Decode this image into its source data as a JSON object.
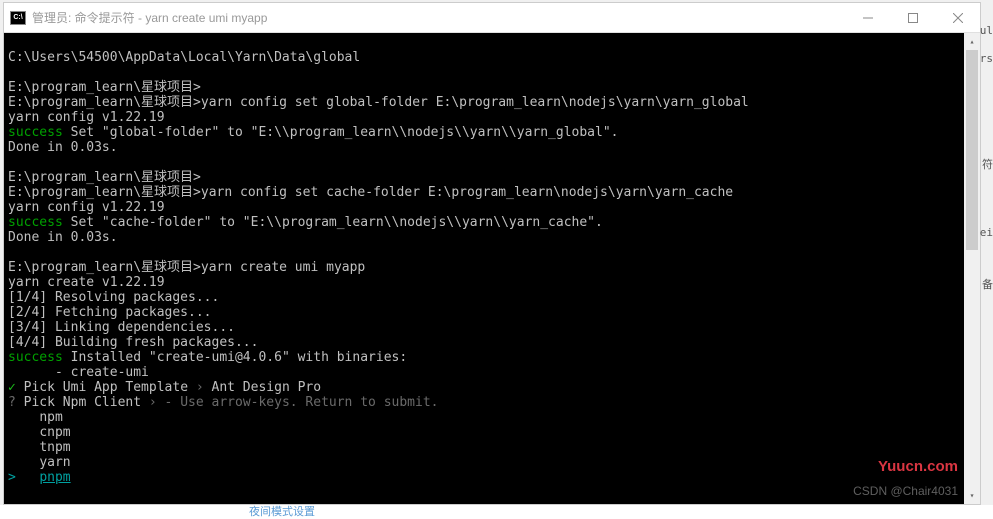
{
  "window": {
    "title": "管理员: 命令提示符 - yarn  create umi myapp",
    "icon_label": "C:\\"
  },
  "path_line": "C:\\Users\\54500\\AppData\\Local\\Yarn\\Data\\global",
  "block1": {
    "prompt1": "E:\\program_learn\\星球项目>",
    "prompt2": "E:\\program_learn\\星球项目>",
    "cmd": "yarn config set global-folder E:\\program_learn\\nodejs\\yarn\\yarn_global",
    "version": "yarn config v1.22.19",
    "success": "success",
    "success_rest": " Set \"global-folder\" to \"E:\\\\program_learn\\\\nodejs\\\\yarn\\\\yarn_global\".",
    "done": "Done in 0.03s."
  },
  "block2": {
    "prompt1": "E:\\program_learn\\星球项目>",
    "prompt2": "E:\\program_learn\\星球项目>",
    "cmd": "yarn config set cache-folder E:\\program_learn\\nodejs\\yarn\\yarn_cache",
    "version": "yarn config v1.22.19",
    "success": "success",
    "success_rest": " Set \"cache-folder\" to \"E:\\\\program_learn\\\\nodejs\\\\yarn\\\\yarn_cache\".",
    "done": "Done in 0.03s."
  },
  "block3": {
    "prompt": "E:\\program_learn\\星球项目>",
    "cmd": "yarn create umi myapp",
    "version": "yarn create v1.22.19",
    "steps": [
      "[1/4] Resolving packages...",
      "[2/4] Fetching packages...",
      "[3/4] Linking dependencies...",
      "[4/4] Building fresh packages..."
    ],
    "success": "success",
    "success_rest": " Installed \"create-umi@4.0.6\" with binaries:",
    "binary": "      - create-umi",
    "q1_check": "✓",
    "q1_label": " Pick Umi App Template",
    "q1_sep": " › ",
    "q1_answer": "Ant Design Pro",
    "q2_mark": "?",
    "q2_label": " Pick Npm Client",
    "q2_sep": " › ",
    "q2_hint": "- Use arrow-keys. Return to submit.",
    "options": [
      "npm",
      "cnpm",
      "tnpm",
      "yarn"
    ],
    "pointer": ">",
    "selected": "pnpm"
  },
  "watermarks": {
    "yuucn": "Yuucn.com",
    "csdn": "CSDN @Chair4031"
  },
  "footer": "夜间模式设置",
  "edge": {
    "ul": "ul",
    "rs": "rs",
    "fu": "符",
    "ei": "ei",
    "bei": "备"
  }
}
